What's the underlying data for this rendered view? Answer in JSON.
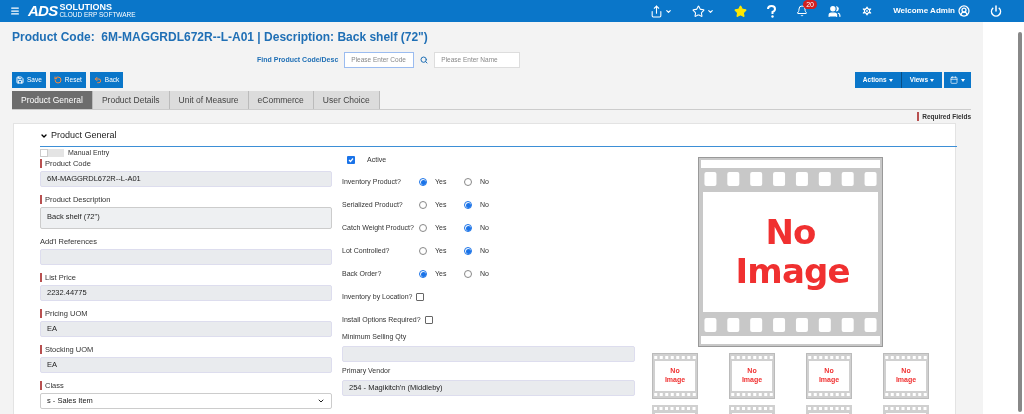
{
  "top_bar": {
    "notification_count": "20",
    "welcome": "Welcome Admin"
  },
  "logo": {
    "mark": "ADS",
    "name": "SOLUTIONS",
    "tagline": "CLOUD ERP SOFTWARE"
  },
  "title": "Product Code:  6M-MAGGRDL672R--L-A01 | Description: Back shelf (72\")",
  "find": {
    "label": "Find Product Code/Desc",
    "code_placeholder": "Please Enter Code",
    "name_placeholder": "Please Enter Name"
  },
  "buttons": [
    {
      "label": "Save",
      "kind": "save"
    },
    {
      "label": "Reset",
      "kind": "reset"
    },
    {
      "label": "Back",
      "kind": "back"
    }
  ],
  "menus": [
    {
      "label": "Actions"
    },
    {
      "label": "Views"
    }
  ],
  "tabs": [
    {
      "label": "Product General",
      "selected": true
    },
    {
      "label": "Product Details",
      "selected": false
    },
    {
      "label": "Unit of Measure",
      "selected": false
    },
    {
      "label": "eCommerce",
      "selected": false
    },
    {
      "label": "User Choice",
      "selected": false
    }
  ],
  "required_note": "Required Fields",
  "section": {
    "title": "Product General",
    "expanded": true
  },
  "manual_entry": {
    "label": "Manual Entry",
    "on": false
  },
  "left_fields": [
    {
      "label": "Product Code",
      "value": "6M-MAGGRDL672R--L-A01",
      "required": true,
      "kind": "input"
    },
    {
      "label": "Product Description",
      "value": "Back shelf (72\")",
      "required": true,
      "kind": "textarea"
    },
    {
      "label": "Add'l References",
      "required": false,
      "kind": "input"
    },
    {
      "label": "List Price",
      "value": "2232.44775",
      "required": true,
      "kind": "input"
    },
    {
      "label": "Pricing UOM",
      "value": "EA",
      "required": true,
      "kind": "input"
    },
    {
      "label": "Stocking UOM",
      "value": "EA",
      "required": true,
      "kind": "input"
    },
    {
      "label": "Class",
      "value": "s - Sales Item",
      "required": true,
      "kind": "select"
    }
  ],
  "active": {
    "label": "Active",
    "checked": true
  },
  "yes_no": [
    {
      "label": "Inventory Product?",
      "options": [
        {
          "label": "Yes",
          "selected": true
        },
        {
          "label": "No",
          "selected": false
        }
      ]
    },
    {
      "label": "Serialized Product?",
      "options": [
        {
          "label": "Yes",
          "selected": false
        },
        {
          "label": "No",
          "selected": true
        }
      ]
    },
    {
      "label": "Catch Weight Product?",
      "options": [
        {
          "label": "Yes",
          "selected": false
        },
        {
          "label": "No",
          "selected": true
        }
      ]
    },
    {
      "label": "Lot Controlled?",
      "options": [
        {
          "label": "Yes",
          "selected": false
        },
        {
          "label": "No",
          "selected": true
        }
      ]
    },
    {
      "label": "Back Order?",
      "options": [
        {
          "label": "Yes",
          "selected": true
        },
        {
          "label": "No",
          "selected": false
        }
      ]
    }
  ],
  "checkboxes": [
    {
      "label": "Inventory by Location?",
      "checked": false
    },
    {
      "label": "Install Options Required?",
      "checked": false
    }
  ],
  "middle_fields": [
    {
      "label": "Minimum Selling Qty"
    },
    {
      "label": "Primary Vendor",
      "value": "254 - Magikitch'n (Middleby)"
    }
  ],
  "main_image": {
    "text": "No Image"
  },
  "thumbnails": [
    {
      "text": "No Image"
    },
    {
      "text": "No Image"
    },
    {
      "text": "No Image"
    },
    {
      "text": "No Image"
    }
  ]
}
